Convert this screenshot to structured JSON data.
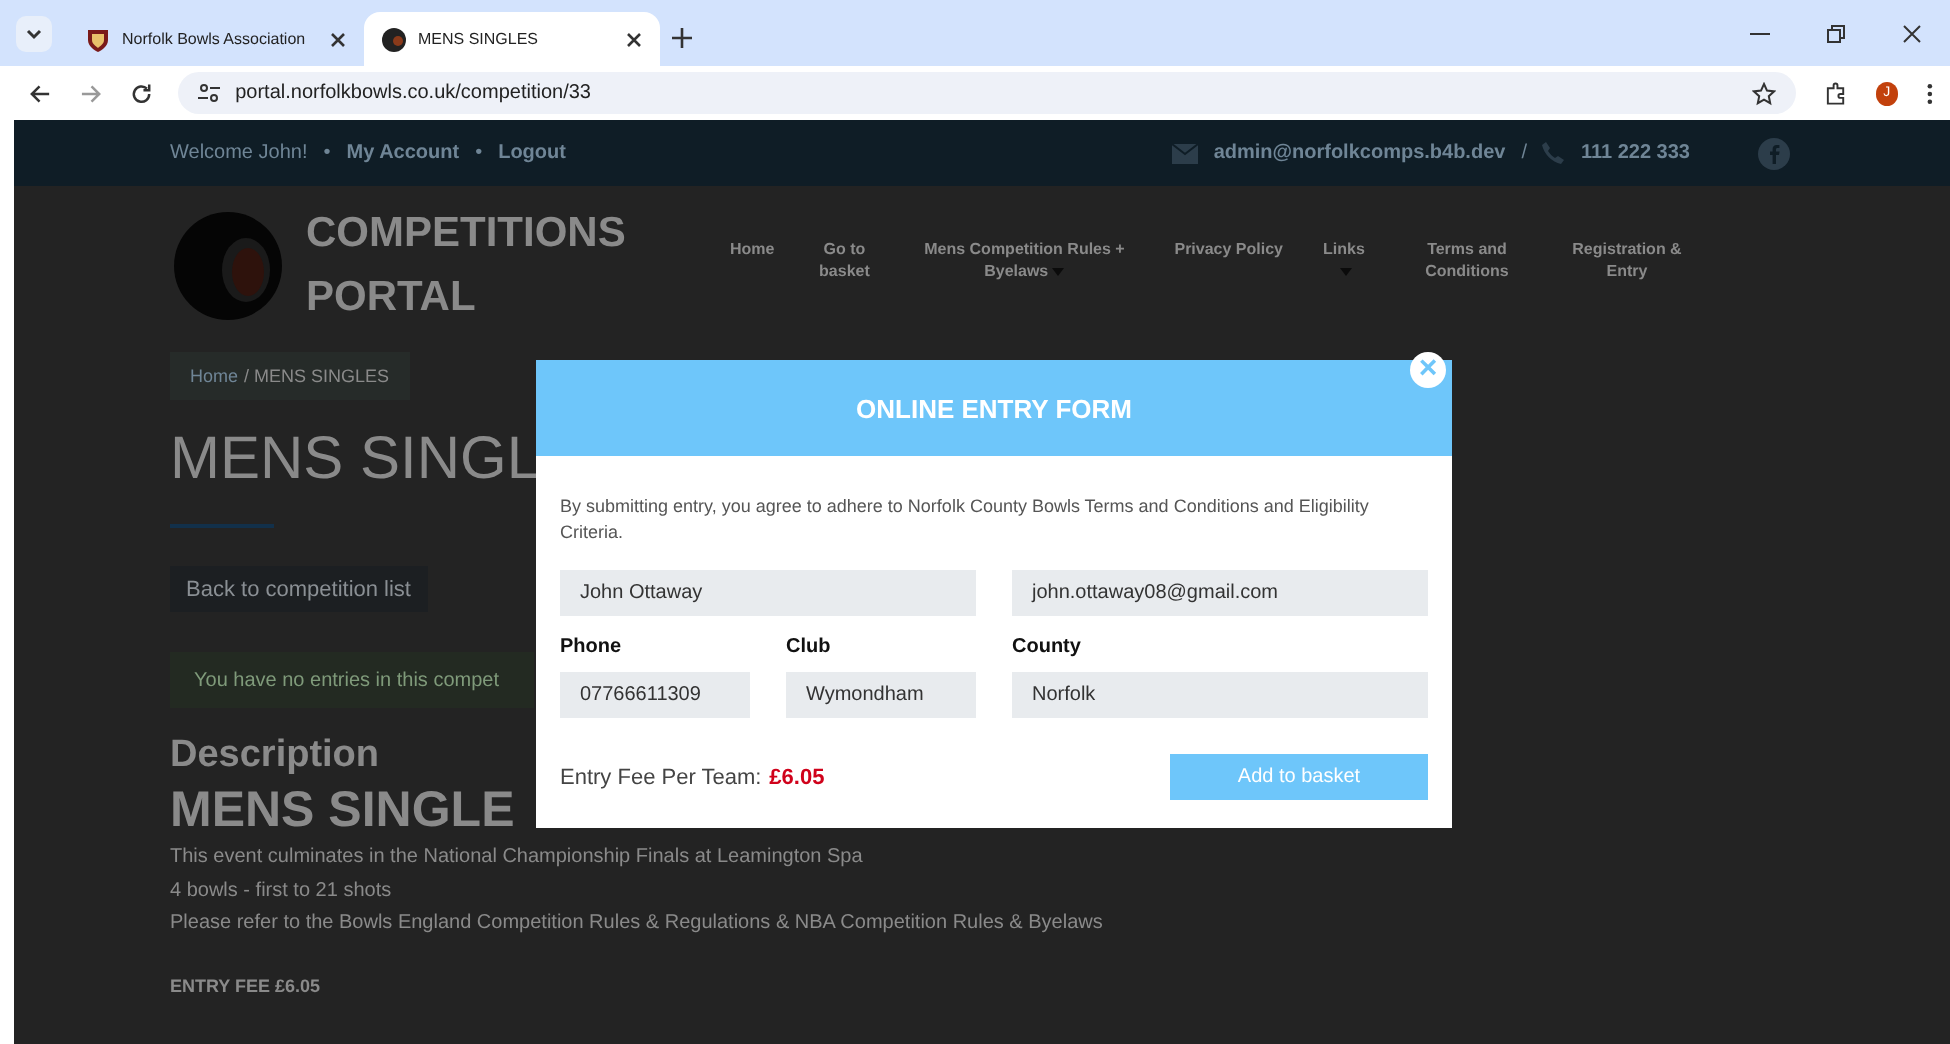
{
  "browser": {
    "tabs": [
      {
        "title": "Norfolk Bowls Association",
        "selected": false
      },
      {
        "title": "MENS SINGLES",
        "selected": true
      }
    ],
    "url": "portal.norfolkbowls.co.uk/competition/33",
    "profile_initial": "J"
  },
  "top_bar": {
    "welcome": "Welcome John!",
    "separator": "•",
    "links": [
      "My Account",
      "Logout"
    ],
    "email": "admin@norfolkcomps.b4b.dev",
    "divider": "/",
    "phone": "111 222 333"
  },
  "site": {
    "logo_title": [
      "COMPETITIONS",
      "PORTAL"
    ],
    "nav": [
      {
        "label": "Home",
        "dropdown": false
      },
      {
        "label": "Go to basket",
        "dropdown": false
      },
      {
        "label": "Mens Competition Rules + Byelaws",
        "dropdown": true
      },
      {
        "label": "Privacy Policy",
        "dropdown": false
      },
      {
        "label": "Links",
        "dropdown": true
      },
      {
        "label": "Terms and Conditions",
        "dropdown": false
      },
      {
        "label": "Registration & Entry",
        "dropdown": false
      }
    ]
  },
  "page": {
    "breadcrumb": {
      "home": "Home",
      "current": "/ MENS SINGLES"
    },
    "title": "MENS SINGL",
    "back_button": "Back to competition list",
    "notice": "You have no entries in this compet",
    "description_heading": "Description",
    "description_title": "MENS SINGLE",
    "paragraphs": [
      "This event culminates in the National Championship Finals at   Leamington Spa",
      "4 bowls - first to 21 shots",
      "Please refer to the Bowls England Competition Rules & Regulations & NBA Competition Rules & Byelaws"
    ],
    "entry_fee": "ENTRY FEE £6.05"
  },
  "modal": {
    "title": "ONLINE ENTRY FORM",
    "close": "×",
    "agreement": "By submitting entry, you agree to adhere to Norfolk County Bowls Terms and Conditions and Eligibility Criteria.",
    "name": "John Ottaway",
    "email": "john.ottaway08@gmail.com",
    "fields": [
      {
        "label": "Phone",
        "value": "07766611309"
      },
      {
        "label": "Club",
        "value": "Wymondham"
      },
      {
        "label": "County",
        "value": "Norfolk"
      }
    ],
    "fee_label": "Entry Fee Per Team:",
    "fee_value": "£6.05",
    "submit": "Add to basket"
  }
}
